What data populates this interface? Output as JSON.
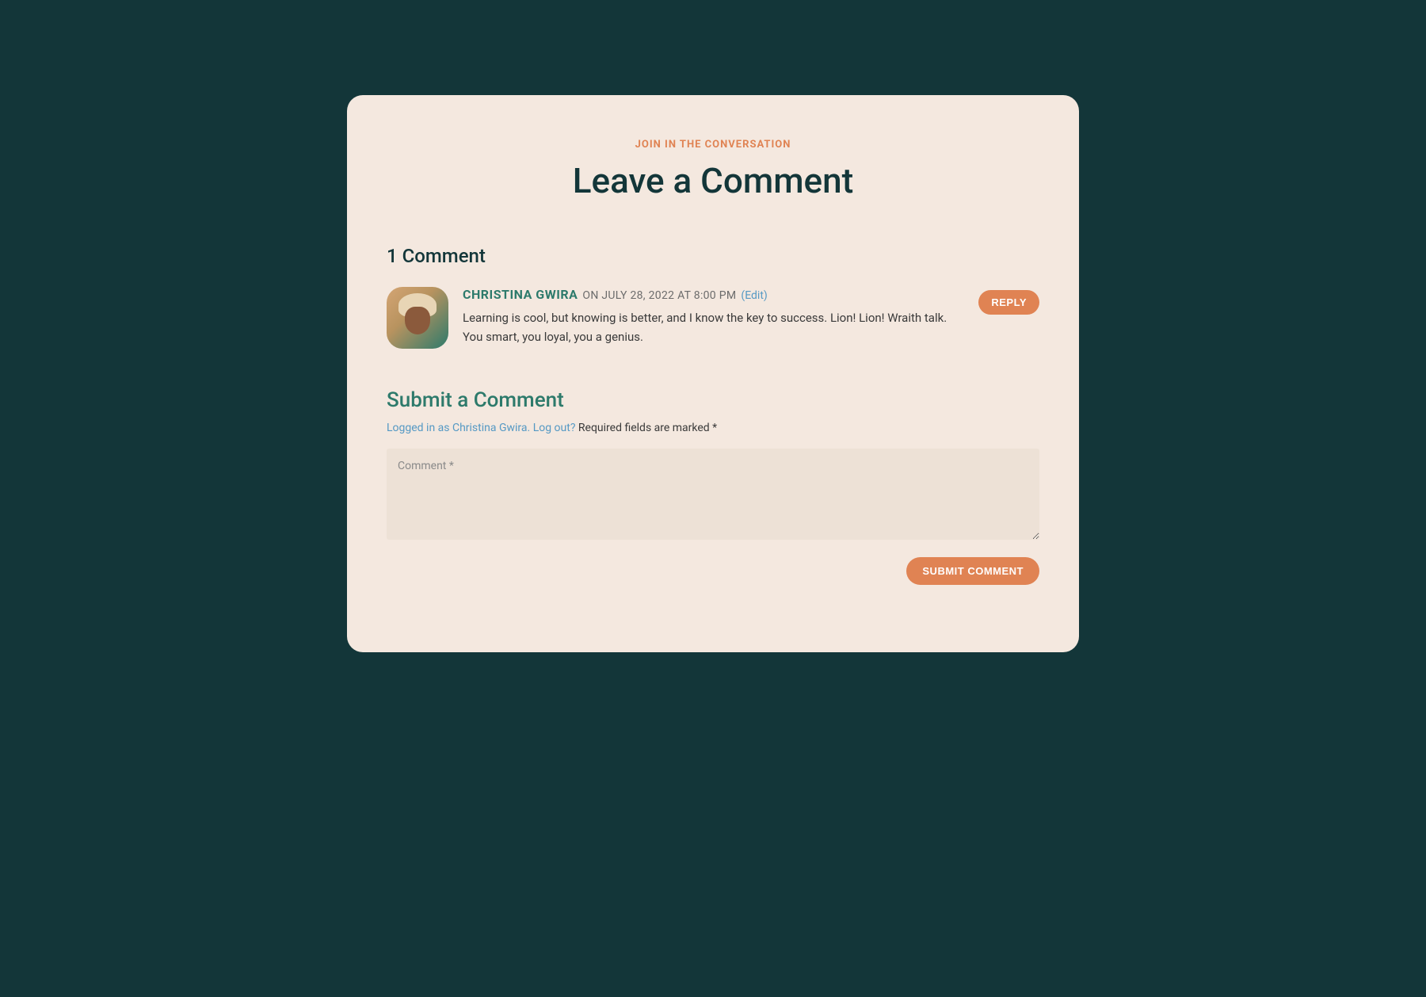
{
  "header": {
    "eyebrow": "JOIN IN THE CONVERSATION",
    "title": "Leave a Comment"
  },
  "comments": {
    "count_label": "1 Comment",
    "items": [
      {
        "author": "CHRISTINA GWIRA",
        "meta": "ON JULY 28, 2022 AT 8:00 PM",
        "edit_label": "(Edit)",
        "text": "Learning is cool, but knowing is better, and I know the key to success. Lion! Lion! Wraith talk. You smart, you loyal, you a genius.",
        "reply_label": "REPLY"
      }
    ]
  },
  "form": {
    "title": "Submit a Comment",
    "logged_in_text": "Logged in as Christina Gwira. ",
    "logout_text": "Log out?",
    "required_text": " Required fields are marked *",
    "comment_placeholder": "Comment *",
    "submit_label": "SUBMIT COMMENT"
  }
}
